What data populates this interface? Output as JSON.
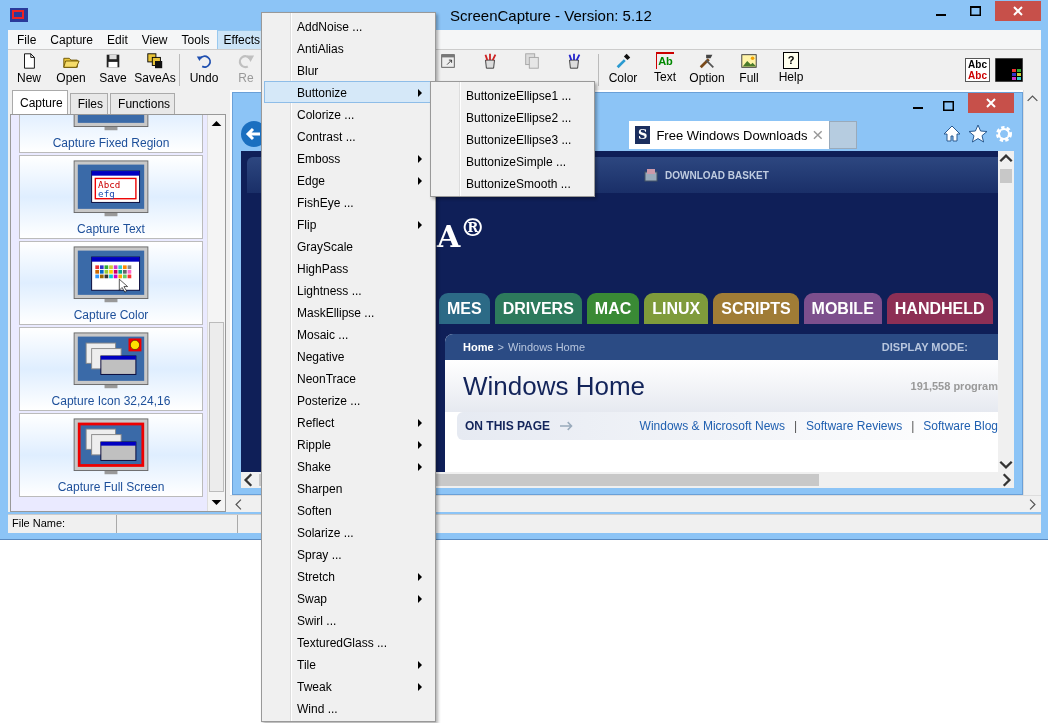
{
  "window": {
    "title": "ScreenCapture - Version: 5.12"
  },
  "menu_bar": [
    {
      "label": "File",
      "selected": false
    },
    {
      "label": "Capture",
      "selected": false
    },
    {
      "label": "Edit",
      "selected": false
    },
    {
      "label": "View",
      "selected": false
    },
    {
      "label": "Tools",
      "selected": false
    },
    {
      "label": "Effects",
      "selected": true
    }
  ],
  "toolbar": {
    "groups": [
      [
        {
          "label": "New",
          "disabled": false
        },
        {
          "label": "Open",
          "disabled": false
        },
        {
          "label": "Save",
          "disabled": false
        },
        {
          "label": "SaveAs",
          "disabled": false
        }
      ],
      [
        {
          "label": "Undo",
          "disabled": false
        },
        {
          "label": "Re",
          "disabled": true
        }
      ],
      [
        {
          "disabled": false
        },
        {
          "disabled": false
        },
        {
          "disabled": true
        },
        {
          "disabled": false
        }
      ],
      [
        {
          "label": "Color",
          "disabled": false
        },
        {
          "label": "Text",
          "disabled": false,
          "icon_text": "Ab"
        },
        {
          "label": "Option",
          "disabled": false
        },
        {
          "label": "Full",
          "disabled": false
        },
        {
          "label": "Help",
          "disabled": false,
          "icon_text": "?"
        }
      ]
    ],
    "font_sample": [
      "Abc",
      "Abc"
    ]
  },
  "side_tabs": [
    {
      "label": "Capture",
      "selected": true
    },
    {
      "label": "Files",
      "selected": false
    },
    {
      "label": "Functions",
      "selected": false
    }
  ],
  "capture_modes": [
    {
      "label": "Capture Fixed Region",
      "kind": "region"
    },
    {
      "label": "Capture Text",
      "kind": "text",
      "sample": [
        "Abcd",
        "efg"
      ]
    },
    {
      "label": "Capture Color",
      "kind": "color"
    },
    {
      "label": "Capture Icon 32,24,16",
      "kind": "icon"
    },
    {
      "label": "Capture Full Screen",
      "kind": "full"
    }
  ],
  "status_bar": [
    "File Name:"
  ],
  "browser": {
    "favicon": "S",
    "tab": "Free Windows Downloads",
    "nav": "DOWNLOAD BASKET",
    "logo": "A$^{®}$",
    "categories": [
      {
        "label": "MES",
        "color": "#2c6a86"
      },
      {
        "label": "DRIVERS",
        "color": "#2d7a5c"
      },
      {
        "label": "MAC",
        "color": "#3a8a35"
      },
      {
        "label": "LINUX",
        "color": "#7f9b3b"
      },
      {
        "label": "SCRIPTS",
        "color": "#a07c36"
      },
      {
        "label": "MOBILE",
        "color": "#7d4f8d"
      },
      {
        "label": "HANDHELD",
        "color": "#8d2f55"
      }
    ],
    "breadcrumb": {
      "home": "Home",
      "separator": ">",
      "current": "Windows Home"
    },
    "display_mode": "DISPLAY MODE:",
    "heading": "Windows Home",
    "count": "191,558 program",
    "on_this_page": "ON THIS PAGE",
    "links": [
      {
        "kind": "link",
        "label": "Windows & Microsoft News"
      },
      {
        "kind": "sep",
        "label": "|"
      },
      {
        "kind": "link",
        "label": "Software Reviews"
      },
      {
        "kind": "sep",
        "label": "|"
      },
      {
        "kind": "link",
        "label": "Software Blog"
      }
    ]
  },
  "effects_menu": [
    {
      "label": "AddNoise ...",
      "submenu": false,
      "selected": false
    },
    {
      "label": "AntiAlias",
      "submenu": false,
      "selected": false
    },
    {
      "label": "Blur",
      "submenu": false,
      "selected": false
    },
    {
      "label": "Buttonize",
      "submenu": true,
      "selected": true
    },
    {
      "label": "Colorize ...",
      "submenu": false,
      "selected": false
    },
    {
      "label": "Contrast ...",
      "submenu": false,
      "selected": false
    },
    {
      "label": "Emboss",
      "submenu": true,
      "selected": false
    },
    {
      "label": "Edge",
      "submenu": true,
      "selected": false
    },
    {
      "label": "FishEye ...",
      "submenu": false,
      "selected": false
    },
    {
      "label": "Flip",
      "submenu": true,
      "selected": false
    },
    {
      "label": "GrayScale",
      "submenu": false,
      "selected": false
    },
    {
      "label": "HighPass",
      "submenu": false,
      "selected": false
    },
    {
      "label": "Lightness ...",
      "submenu": false,
      "selected": false
    },
    {
      "label": "MaskEllipse ...",
      "submenu": false,
      "selected": false
    },
    {
      "label": "Mosaic ...",
      "submenu": false,
      "selected": false
    },
    {
      "label": "Negative",
      "submenu": false,
      "selected": false
    },
    {
      "label": "NeonTrace",
      "submenu": false,
      "selected": false
    },
    {
      "label": "Posterize ...",
      "submenu": false,
      "selected": false
    },
    {
      "label": "Reflect",
      "submenu": true,
      "selected": false
    },
    {
      "label": "Ripple",
      "submenu": true,
      "selected": false
    },
    {
      "label": "Shake",
      "submenu": true,
      "selected": false
    },
    {
      "label": "Sharpen",
      "submenu": false,
      "selected": false
    },
    {
      "label": "Soften",
      "submenu": false,
      "selected": false
    },
    {
      "label": "Solarize ...",
      "submenu": false,
      "selected": false
    },
    {
      "label": "Spray ...",
      "submenu": false,
      "selected": false
    },
    {
      "label": "Stretch",
      "submenu": true,
      "selected": false
    },
    {
      "label": "Swap",
      "submenu": true,
      "selected": false
    },
    {
      "label": "Swirl ...",
      "submenu": false,
      "selected": false
    },
    {
      "label": "TexturedGlass ...",
      "submenu": false,
      "selected": false
    },
    {
      "label": "Tile",
      "submenu": true,
      "selected": false
    },
    {
      "label": "Tweak",
      "submenu": true,
      "selected": false
    },
    {
      "label": "Wind ...",
      "submenu": false,
      "selected": false
    }
  ],
  "buttonize_submenu": [
    {
      "label": "ButtonizeEllipse1 ...",
      "selected": false
    },
    {
      "label": "ButtonizeEllipse2 ...",
      "selected": false
    },
    {
      "label": "ButtonizeEllipse3 ...",
      "selected": false
    },
    {
      "label": "ButtonizeSimple ...",
      "selected": false
    },
    {
      "label": "ButtonizeSmooth ...",
      "selected": false
    }
  ]
}
